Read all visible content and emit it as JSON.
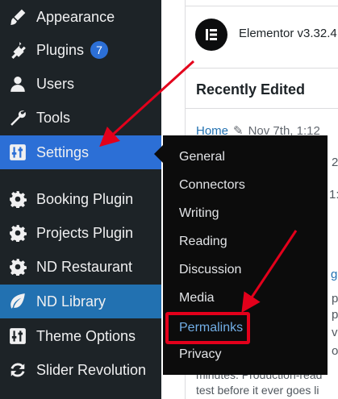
{
  "sidebar": {
    "items": [
      {
        "label": "Appearance",
        "icon": "paintbrush-icon"
      },
      {
        "label": "Plugins",
        "icon": "plugin-icon",
        "badge": "7"
      },
      {
        "label": "Users",
        "icon": "user-icon"
      },
      {
        "label": "Tools",
        "icon": "wrench-icon"
      },
      {
        "label": "Settings",
        "icon": "settings-sliders-icon"
      },
      {
        "label": "Booking Plugin",
        "icon": "gear-icon"
      },
      {
        "label": "Projects Plugin",
        "icon": "gear-icon"
      },
      {
        "label": "ND Restaurant",
        "icon": "gear-icon"
      },
      {
        "label": "ND Library",
        "icon": "leaf-icon"
      },
      {
        "label": "Theme Options",
        "icon": "settings-sliders-icon"
      },
      {
        "label": "Slider Revolution",
        "icon": "refresh-icon"
      }
    ]
  },
  "settings_submenu": {
    "items": [
      "General",
      "Connectors",
      "Writing",
      "Reading",
      "Discussion",
      "Media",
      "Permalinks",
      "Privacy"
    ],
    "highlighted": "Permalinks"
  },
  "elementor": {
    "logo_letter": "E",
    "version": "Elementor v3.32.4"
  },
  "recently_edited": {
    "title": "Recently Edited",
    "item_link": "Home",
    "item_date": "Nov 7th, 1:12"
  },
  "fragments": {
    "f1": "2",
    "f2": "1:",
    "f3": "g",
    "f4": "p",
    "f5": "p",
    "f6": "v",
    "f7": "o"
  },
  "body_text": {
    "line1": "minutes. Production-read",
    "line2": "test before it ever goes li"
  },
  "colors": {
    "sidebar_bg": "#1d2327",
    "settings_active": "#2c6fd6",
    "nd_library_active": "#2271b1",
    "flyout_bg": "#0c0c0c",
    "highlight_red": "#e3001b",
    "link_blue": "#2271b1"
  }
}
